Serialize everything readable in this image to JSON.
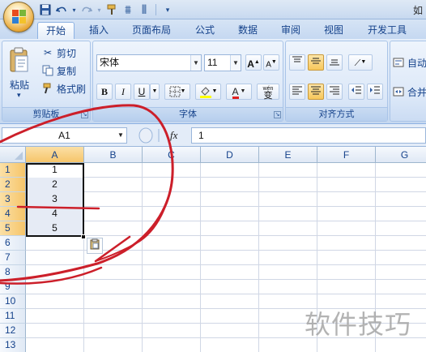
{
  "window": {
    "title_partial": "如"
  },
  "quick_access": {
    "icons": [
      "save-icon",
      "undo-icon",
      "redo-icon",
      "format-painter-icon"
    ]
  },
  "tabs": [
    "开始",
    "插入",
    "页面布局",
    "公式",
    "数据",
    "审阅",
    "视图",
    "开发工具"
  ],
  "active_tab": "开始",
  "clipboard": {
    "paste_label": "粘贴",
    "cut_label": "剪切",
    "copy_label": "复制",
    "format_painter_label": "格式刷",
    "group_label": "剪贴板"
  },
  "font": {
    "font_name": "宋体",
    "font_size": "11",
    "bold": "B",
    "italic": "I",
    "underline": "U",
    "font_color_letter": "A",
    "phonetic": "wén",
    "phonetic_char": "变",
    "grow": "A",
    "shrink": "A",
    "group_label": "字体"
  },
  "alignment": {
    "auto_wrap_label": "自动",
    "merge_label": "合并",
    "group_label": "对齐方式"
  },
  "formula_bar": {
    "name_box": "A1",
    "fx_label": "fx",
    "value": "1"
  },
  "grid": {
    "columns": [
      "A",
      "B",
      "C",
      "D",
      "E",
      "F",
      "G"
    ],
    "rows": [
      "1",
      "2",
      "3",
      "4",
      "5",
      "6",
      "7",
      "8",
      "9",
      "10",
      "11",
      "12",
      "13"
    ],
    "cells_A": [
      "1",
      "2",
      "3",
      "4",
      "5"
    ]
  },
  "colors": {
    "accent": "#15428b",
    "selection_header": "#f6c56a",
    "annotation": "#cc1f2a"
  },
  "watermark": "软件技巧"
}
